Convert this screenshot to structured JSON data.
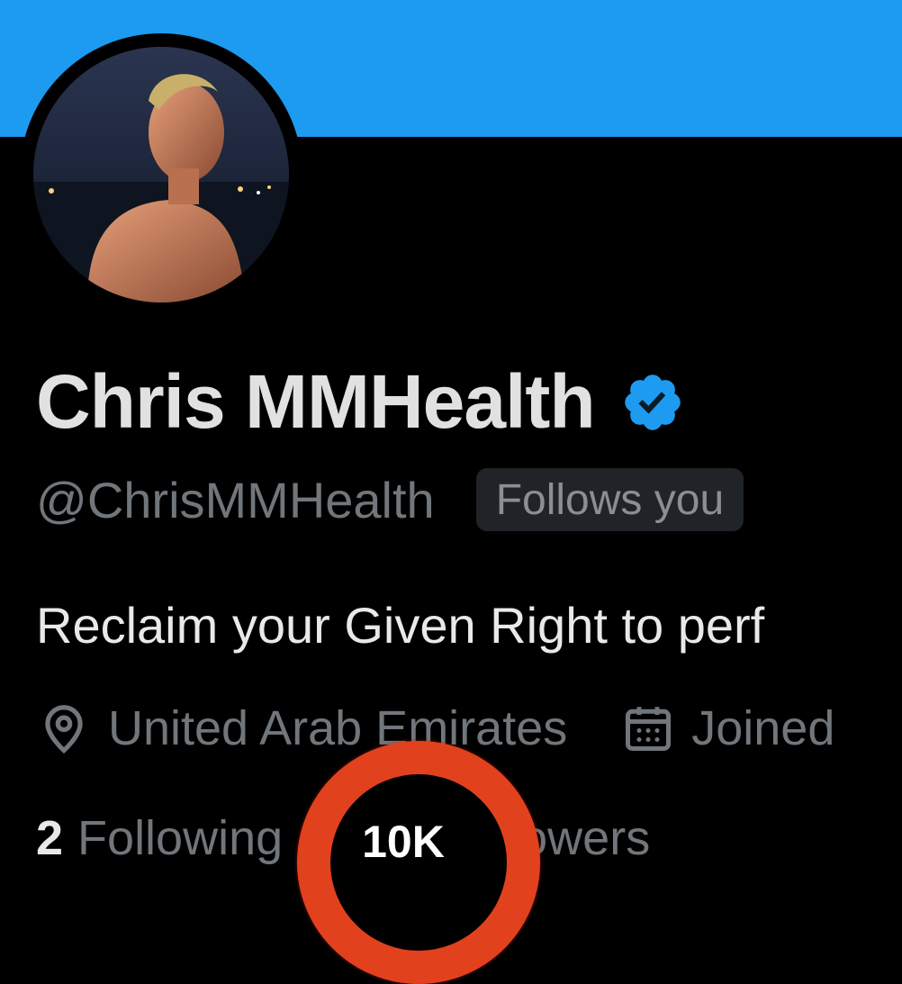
{
  "profile": {
    "display_name": "Chris MMHealth",
    "handle": "@ChrisMMHealth",
    "follows_you": "Follows you",
    "bio": "Reclaim your Given Right to perf",
    "location": "United Arab Emirates",
    "joined": "Joined",
    "following_count": "2",
    "following_label": "Following",
    "followers_label": "llowers"
  },
  "highlight": {
    "text": "10K"
  },
  "icons": {
    "verified": "verified-badge-icon",
    "location": "location-pin-icon",
    "calendar": "calendar-icon"
  },
  "colors": {
    "banner": "#1d9bf0",
    "verified": "#1d9bf0",
    "highlight_ring": "#e2411e"
  }
}
